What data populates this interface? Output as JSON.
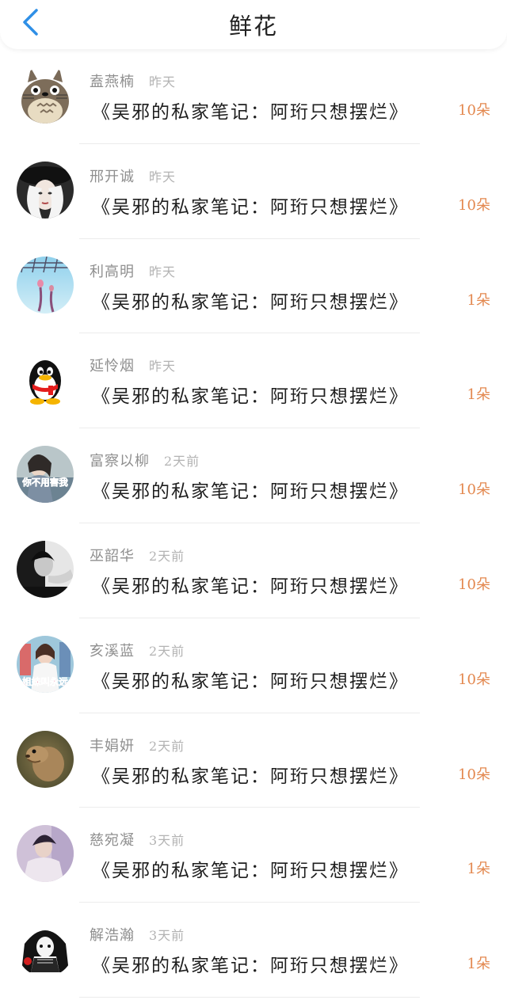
{
  "header": {
    "title": "鲜花",
    "back_icon": "chevron-left-icon",
    "accent_color": "#2f8fe6"
  },
  "flower_color": "#e3884f",
  "gifts": [
    {
      "user": "盍燕楠",
      "time": "昨天",
      "book": "《吴邪的私家笔记：阿珩只想摆烂》",
      "count": "10朵",
      "avatar": "totoro"
    },
    {
      "user": "邢开诚",
      "time": "昨天",
      "book": "《吴邪的私家笔记：阿珩只想摆烂》",
      "count": "10朵",
      "avatar": "woman-hat"
    },
    {
      "user": "利高明",
      "time": "昨天",
      "book": "《吴邪的私家笔记：阿珩只想摆烂》",
      "count": "1朵",
      "avatar": "sky-scene"
    },
    {
      "user": "延怜烟",
      "time": "昨天",
      "book": "《吴邪的私家笔记：阿珩只想摆烂》",
      "count": "1朵",
      "avatar": "qq-penguin"
    },
    {
      "user": "富察以柳",
      "time": "2天前",
      "book": "《吴邪的私家笔记：阿珩只想摆烂》",
      "count": "10朵",
      "avatar": "woman-caption",
      "caption": "你不用害我"
    },
    {
      "user": "巫韶华",
      "time": "2天前",
      "book": "《吴邪的私家笔记：阿珩只想摆烂》",
      "count": "10朵",
      "avatar": "bw-woman"
    },
    {
      "user": "亥溪蓝",
      "time": "2天前",
      "book": "《吴邪的私家笔记：阿珩只想摆烂》",
      "count": "10朵",
      "avatar": "girl-caption",
      "caption": "姐妹叫永远"
    },
    {
      "user": "丰娟妍",
      "time": "2天前",
      "book": "《吴邪的私家笔记：阿珩只想摆烂》",
      "count": "10朵",
      "avatar": "prairie-dog"
    },
    {
      "user": "慈宛凝",
      "time": "3天前",
      "book": "《吴邪的私家笔记：阿珩只想摆烂》",
      "count": "1朵",
      "avatar": "young-man"
    },
    {
      "user": "解浩瀚",
      "time": "3天前",
      "book": "《吴邪的私家笔记：阿珩只想摆烂》",
      "count": "1朵",
      "avatar": "anime-girl"
    }
  ]
}
